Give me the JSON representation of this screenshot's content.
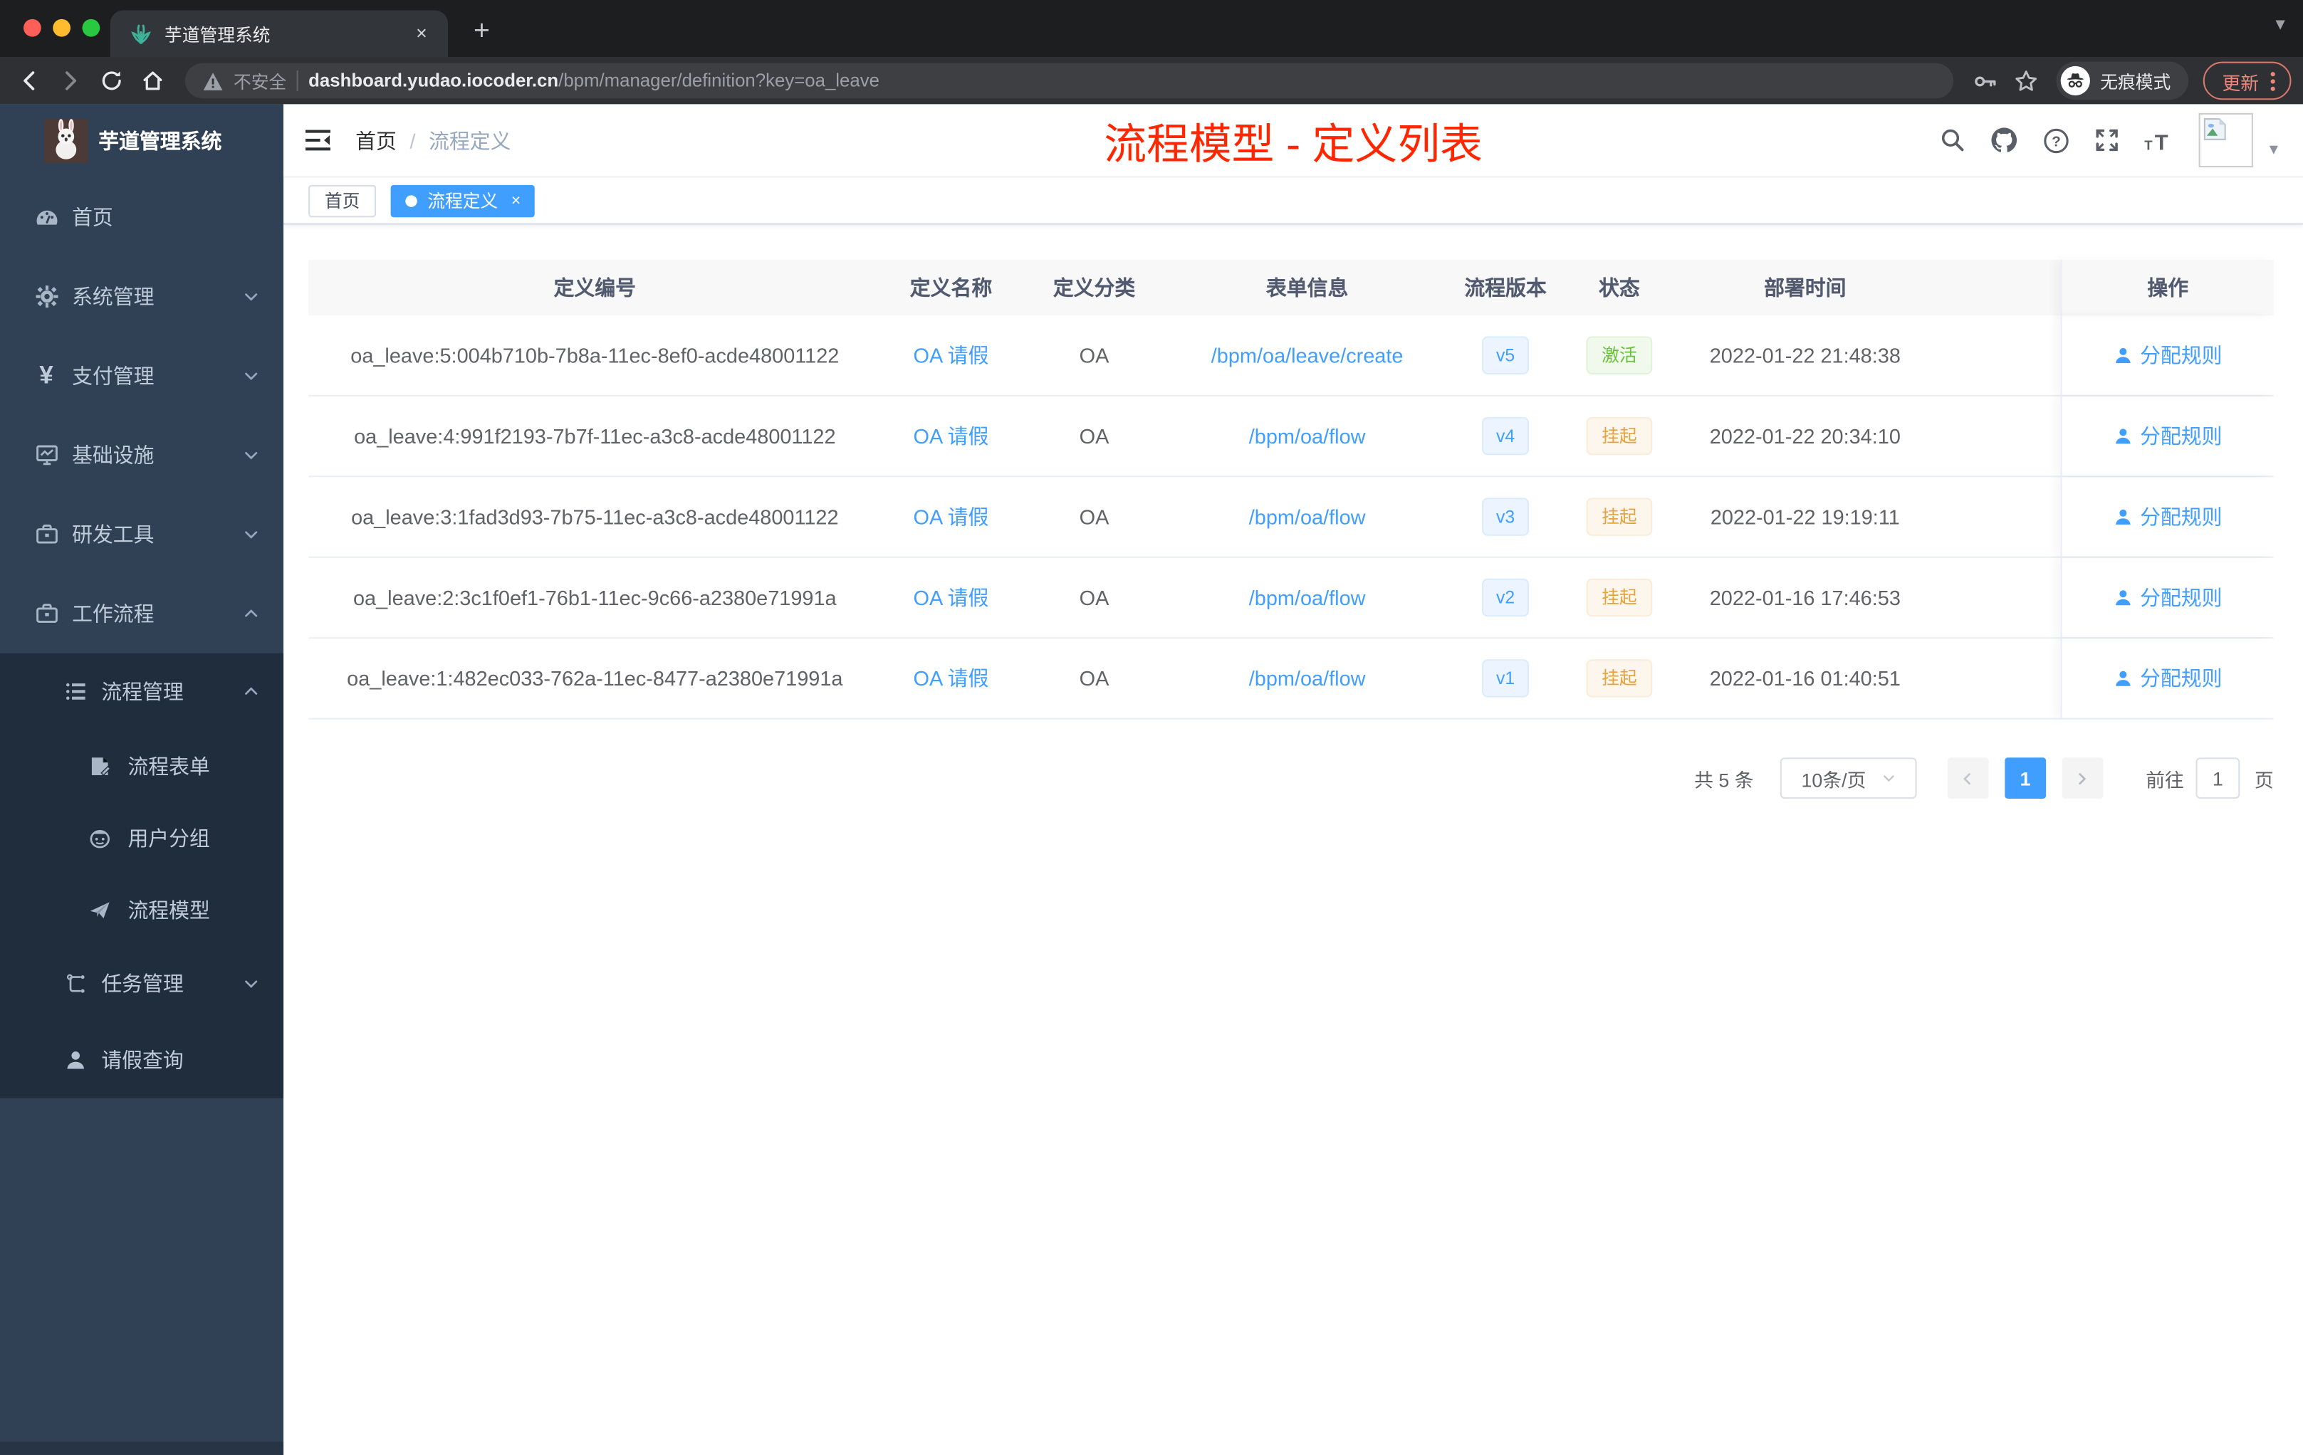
{
  "browser": {
    "tab_title": "芋道管理系统",
    "tab_close": "×",
    "new_tab": "+",
    "security_label": "不安全",
    "url_host": "dashboard.yudao.iocoder.cn",
    "url_path": "/bpm/manager/definition?key=oa_leave",
    "incognito_label": "无痕模式",
    "update_label": "更新",
    "traffic_colors": {
      "close": "#ff5f57",
      "minimize": "#febc2e",
      "zoom": "#28c840"
    }
  },
  "sidebar": {
    "brand": "芋道管理系统",
    "items": [
      {
        "label": "首页"
      },
      {
        "label": "系统管理"
      },
      {
        "label": "支付管理"
      },
      {
        "label": "基础设施"
      },
      {
        "label": "研发工具"
      },
      {
        "label": "工作流程"
      }
    ],
    "submenu": [
      {
        "label": "流程管理"
      },
      {
        "label": "流程表单"
      },
      {
        "label": "用户分组"
      },
      {
        "label": "流程模型"
      },
      {
        "label": "任务管理"
      },
      {
        "label": "请假查询"
      }
    ]
  },
  "navbar": {
    "breadcrumb_home": "首页",
    "breadcrumb_separator": "/",
    "breadcrumb_current": "流程定义",
    "overlay_title": "流程模型 - 定义列表"
  },
  "chipbar": {
    "tabs": [
      {
        "label": "首页"
      },
      {
        "label": "流程定义",
        "close": "×"
      }
    ]
  },
  "table": {
    "columns": [
      "定义编号",
      "定义名称",
      "定义分类",
      "表单信息",
      "流程版本",
      "状态",
      "部署时间",
      "操作"
    ],
    "rows": [
      {
        "id": "oa_leave:5:004b710b-7b8a-11ec-8ef0-acde48001122",
        "name": "OA 请假",
        "category": "OA",
        "form": "/bpm/oa/leave/create",
        "version": "v5",
        "status": "激活",
        "status_variant": "success",
        "deployed": "2022-01-22 21:48:38",
        "action": "分配规则"
      },
      {
        "id": "oa_leave:4:991f2193-7b7f-11ec-a3c8-acde48001122",
        "name": "OA 请假",
        "category": "OA",
        "form": "/bpm/oa/flow",
        "version": "v4",
        "status": "挂起",
        "status_variant": "warning",
        "deployed": "2022-01-22 20:34:10",
        "action": "分配规则"
      },
      {
        "id": "oa_leave:3:1fad3d93-7b75-11ec-a3c8-acde48001122",
        "name": "OA 请假",
        "category": "OA",
        "form": "/bpm/oa/flow",
        "version": "v3",
        "status": "挂起",
        "status_variant": "warning",
        "deployed": "2022-01-22 19:19:11",
        "action": "分配规则"
      },
      {
        "id": "oa_leave:2:3c1f0ef1-76b1-11ec-9c66-a2380e71991a",
        "name": "OA 请假",
        "category": "OA",
        "form": "/bpm/oa/flow",
        "version": "v2",
        "status": "挂起",
        "status_variant": "warning",
        "deployed": "2022-01-16 17:46:53",
        "action": "分配规则"
      },
      {
        "id": "oa_leave:1:482ec033-762a-11ec-8477-a2380e71991a",
        "name": "OA 请假",
        "category": "OA",
        "form": "/bpm/oa/flow",
        "version": "v1",
        "status": "挂起",
        "status_variant": "warning",
        "deployed": "2022-01-16 01:40:51",
        "action": "分配规则"
      }
    ]
  },
  "pagination": {
    "total": "共 5 条",
    "page_size": "10条/页",
    "current_page": "1",
    "goto_label": "前往",
    "goto_value": "1",
    "page_unit": "页"
  },
  "colors": {
    "accent": "#409eff",
    "annotation_red": "#ff2600",
    "status_active_green": "#67c23a",
    "status_suspend_orange": "#e6a23c",
    "sidebar_bg": "#304156",
    "submenu_bg": "#1f2d3d"
  }
}
